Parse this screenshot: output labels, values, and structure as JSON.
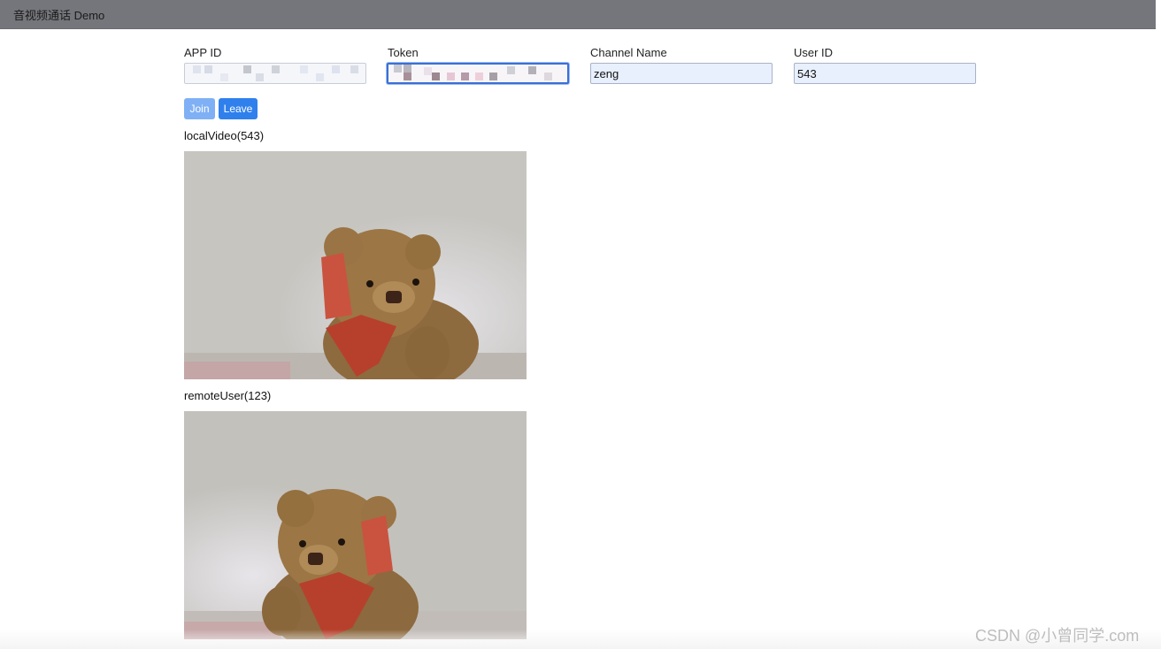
{
  "navbar": {
    "title": "音视频通话 Demo"
  },
  "form": {
    "app_id": {
      "label": "APP ID",
      "value": ""
    },
    "token": {
      "label": "Token",
      "value": ""
    },
    "channel_name": {
      "label": "Channel Name",
      "value": "zeng"
    },
    "user_id": {
      "label": "User ID",
      "value": "543"
    }
  },
  "buttons": {
    "join_label": "Join",
    "leave_label": "Leave"
  },
  "local_video": {
    "label": "localVideo(543)"
  },
  "remote_video": {
    "label": "remoteUser(123)"
  },
  "watermark": "CSDN @小曾同学.com",
  "colors": {
    "navbar": "#75767b",
    "join_button": "#7fb0f5",
    "leave_button": "#2f80ed",
    "input_autofill": "#e8f0fe"
  }
}
